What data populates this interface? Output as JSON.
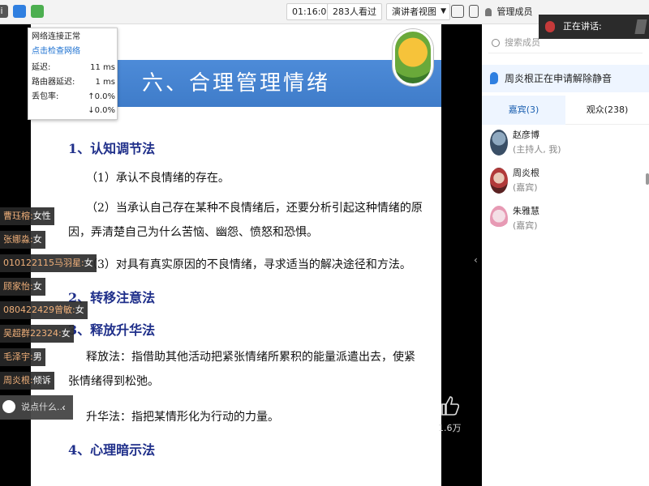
{
  "toolbar": {
    "time": "01:16:08",
    "viewers": "283人看过",
    "view_mode": "演讲者视图",
    "members_label": "管理成员"
  },
  "speaking": {
    "label": "正在讲话:"
  },
  "network": {
    "status": "网络连接正常",
    "check_link": "点击检查网络",
    "rows": [
      {
        "label": "延迟:",
        "value": "11 ms"
      },
      {
        "label": "路由器延迟:",
        "value": "1 ms"
      },
      {
        "label": "丢包率:",
        "value": "↑0.0%"
      },
      {
        "label": "",
        "value": "↓0.0%"
      }
    ]
  },
  "slide": {
    "title": "六、合理管理情绪",
    "sections": [
      {
        "heading": "1、认知调节法"
      },
      {
        "heading": "2、转移注意法"
      },
      {
        "heading": "3、释放升华法"
      },
      {
        "heading": "4、心理暗示法"
      }
    ],
    "paras": [
      "（1）承认不良情绪的存在。",
      "（2）当承认自己存在某种不良情绪后，还要分析引起这种情绪的原因，弄清楚自己为什么苦恼、幽怨、愤怒和恐惧。",
      "（3）对具有真实原因的不良情绪，寻求适当的解决途径和方法。",
      "释放法：指借助其他活动把紧张情绪所累积的能量派遣出去，使紧张情绪得到松弛。",
      "升华法：指把某情形化为行动的力量。"
    ]
  },
  "chat": {
    "lines": [
      {
        "name": "曹珏榕:",
        "text": "女性"
      },
      {
        "name": "张娜淼:",
        "text": "女"
      },
      {
        "name": "010122115马羽星:",
        "text": "女"
      },
      {
        "name": "顾家怡:",
        "text": "女"
      },
      {
        "name": "080422429曾敏:",
        "text": "女"
      },
      {
        "name": "吴超群22324:",
        "text": "女"
      },
      {
        "name": "毛泽宇:",
        "text": "男"
      },
      {
        "name": "周炎根:",
        "text": "倾诉"
      }
    ],
    "input_placeholder": "说点什么..."
  },
  "like": {
    "count": "1.6万"
  },
  "panel": {
    "search_placeholder": "搜索成员",
    "notice": "周炎根正在申请解除静音",
    "tabs": [
      {
        "label": "嘉宾(3)"
      },
      {
        "label": "观众(238)"
      }
    ],
    "members": [
      {
        "name": "赵彦博",
        "role": "(主持人, 我)"
      },
      {
        "name": "周炎根",
        "role": "(嘉宾)"
      },
      {
        "name": "朱雅慧",
        "role": "(嘉宾)"
      }
    ]
  },
  "colors": {
    "title_band": "#3f7cc9",
    "heading": "#1f2f8a",
    "accent": "#1a6fd0",
    "chat_name": "#f0b07a"
  }
}
